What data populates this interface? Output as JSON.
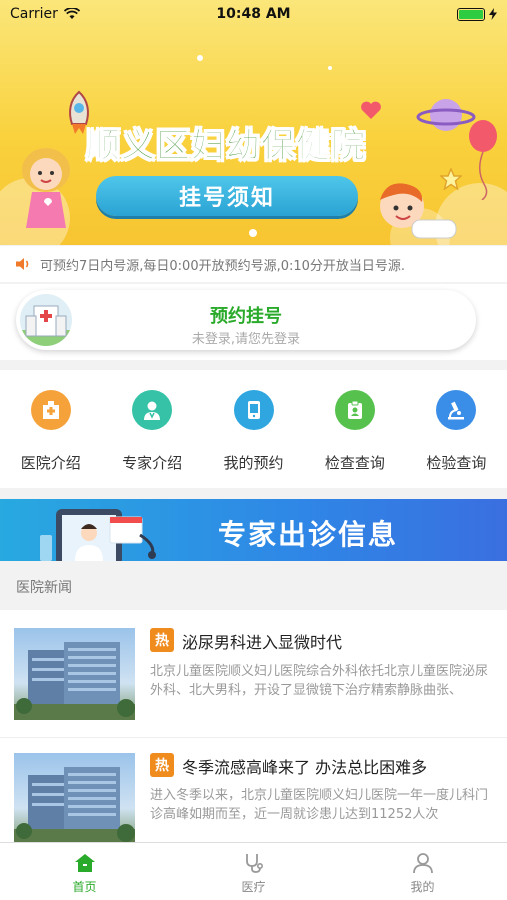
{
  "status_bar": {
    "carrier": "Carrier",
    "time": "10:48 AM"
  },
  "banner": {
    "title": "顺义区妇幼保健院",
    "button": "挂号须知"
  },
  "notice": {
    "text": "可预约7日内号源,每日0:00开放预约号源,0:10分开放当日号源."
  },
  "appointment": {
    "title": "预约挂号",
    "subtitle": "未登录,请您先登录"
  },
  "menu": [
    {
      "label": "医院介绍",
      "icon": "hospital-icon",
      "color": "#f6a23b"
    },
    {
      "label": "专家介绍",
      "icon": "doctor-icon",
      "color": "#35c2a6"
    },
    {
      "label": "我的预约",
      "icon": "phone-booking-icon",
      "color": "#2fa6e0"
    },
    {
      "label": "检查查询",
      "icon": "clipboard-icon",
      "color": "#56c24d"
    },
    {
      "label": "检验查询",
      "icon": "microscope-icon",
      "color": "#3a8ee8"
    }
  ],
  "expert_banner": {
    "title": "专家出诊信息"
  },
  "news_section": {
    "title": "医院新闻"
  },
  "news": [
    {
      "badge": "热",
      "title": "泌尿男科进入显微时代",
      "desc": "北京儿童医院顺义妇儿医院综合外科依托北京儿童医院泌尿外科、北大男科，开设了显微镜下治疗精索静脉曲张、"
    },
    {
      "badge": "热",
      "title": "冬季流感高峰来了 办法总比困难多",
      "desc": "进入冬季以来，北京儿童医院顺义妇儿医院一年一度儿科门诊高峰如期而至，近一周就诊患儿达到11252人次"
    }
  ],
  "tabs": [
    {
      "label": "首页",
      "icon": "home-icon",
      "active": true
    },
    {
      "label": "医疗",
      "icon": "stethoscope-icon",
      "active": false
    },
    {
      "label": "我的",
      "icon": "user-icon",
      "active": false
    }
  ],
  "colors": {
    "accent": "#2aaa2a",
    "banner_yellow": "#f9d23e",
    "hot_badge": "#f08b1e"
  }
}
